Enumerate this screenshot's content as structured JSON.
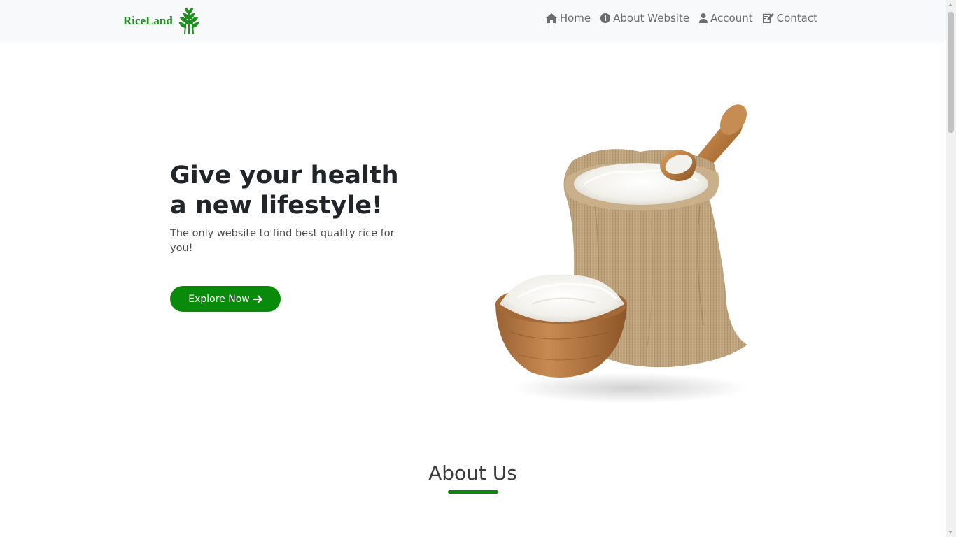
{
  "brand": {
    "name": "RiceLand",
    "color": "#1e8f1e",
    "icon": "wheat-icon"
  },
  "nav": {
    "items": [
      {
        "label": "Home",
        "icon": "home-icon"
      },
      {
        "label": "About Website",
        "icon": "info-circle-icon"
      },
      {
        "label": "Account",
        "icon": "user-icon"
      },
      {
        "label": "Contact",
        "icon": "edit-icon"
      }
    ]
  },
  "hero": {
    "title_line1": "Give your health",
    "title_line2": "a new lifestyle!",
    "subtitle": "The only website to find best quality rice for you!",
    "button_label": "Explore Now",
    "button_icon": "arrow-right-icon",
    "image": "rice-sack-bowl-image"
  },
  "about": {
    "title": "About Us"
  },
  "colors": {
    "accent": "#0a8a0a",
    "navbar_bg": "#f8f9fa",
    "text_dark": "#212529"
  }
}
